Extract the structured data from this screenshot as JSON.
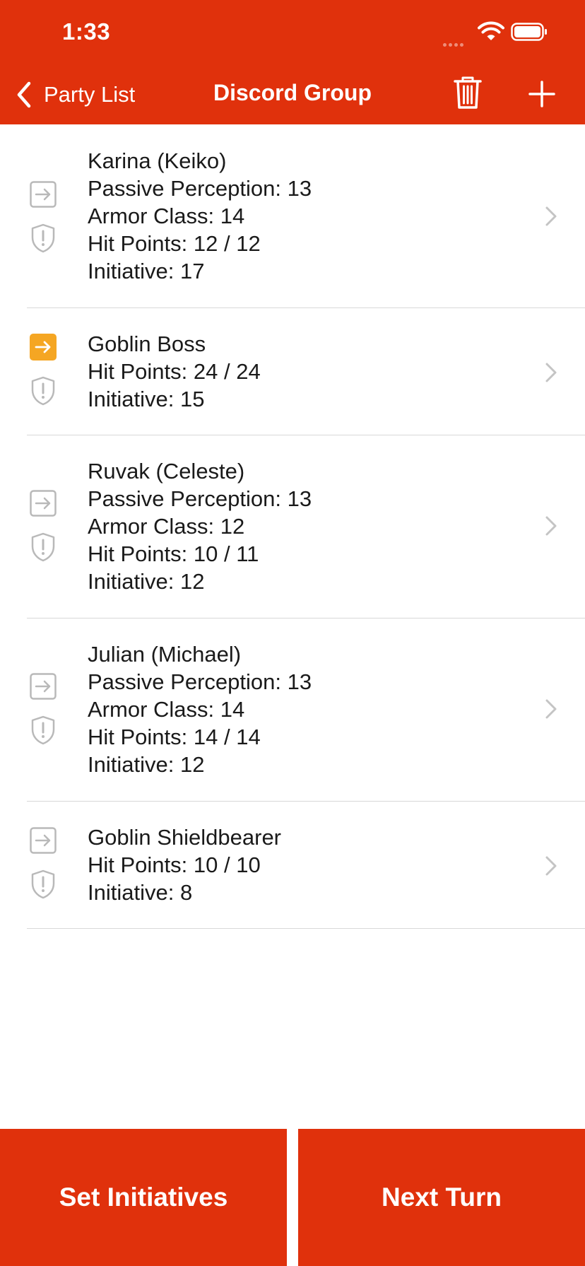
{
  "status_bar": {
    "time": "1:33"
  },
  "nav": {
    "back_label": "Party List",
    "title": "Discord Group"
  },
  "combatants": [
    {
      "name": "Karina (Keiko)",
      "stats": [
        "Passive Perception: 13",
        "Armor Class: 14",
        "Hit Points: 12 / 12",
        "Initiative: 17"
      ],
      "active_turn": false
    },
    {
      "name": "Goblin Boss",
      "stats": [
        "Hit Points: 24 / 24",
        "Initiative: 15"
      ],
      "active_turn": true
    },
    {
      "name": "Ruvak (Celeste)",
      "stats": [
        "Passive Perception: 13",
        "Armor Class: 12",
        "Hit Points: 10 / 11",
        "Initiative: 12"
      ],
      "active_turn": false
    },
    {
      "name": "Julian (Michael)",
      "stats": [
        "Passive Perception: 13",
        "Armor Class: 14",
        "Hit Points: 14 / 14",
        "Initiative: 12"
      ],
      "active_turn": false
    },
    {
      "name": "Goblin Shieldbearer",
      "stats": [
        "Hit Points: 10 / 10",
        "Initiative: 8"
      ],
      "active_turn": false
    }
  ],
  "footer": {
    "set_initiatives_label": "Set Initiatives",
    "next_turn_label": "Next Turn"
  },
  "colors": {
    "accent": "#e0310c",
    "active_turn": "#f5a623",
    "icon_gray": "#b9b9b9"
  },
  "icons": {
    "back": "chevron-left-icon",
    "trash": "trash-icon",
    "add": "plus-icon",
    "turn": "arrow-right-square-icon",
    "status": "shield-exclamation-icon",
    "disclosure": "chevron-right-icon"
  }
}
